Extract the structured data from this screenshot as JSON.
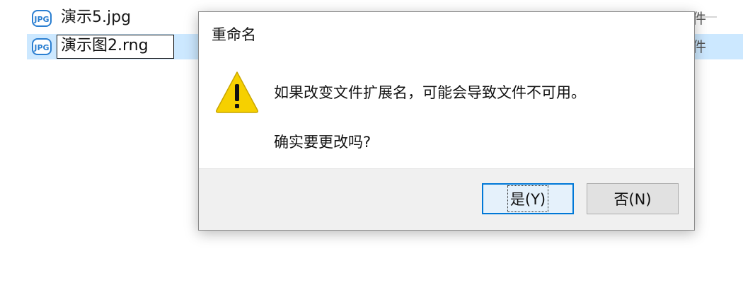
{
  "files": [
    {
      "name": "演示5.jpg",
      "type_text": "件"
    },
    {
      "name": "演示图2.rng",
      "type_text": "件",
      "renaming": true
    }
  ],
  "dialog": {
    "title": "重命名",
    "message": "如果改变文件扩展名，可能会导致文件不可用。",
    "question": "确实要更改吗?",
    "yes_label": "是(Y)",
    "no_label": "否(N)"
  },
  "icons": {
    "file": "jpg-file-icon",
    "warning": "warning-icon"
  },
  "colors": {
    "selection": "#cce8ff",
    "accent": "#0078d7",
    "warning": "#f6d000"
  }
}
